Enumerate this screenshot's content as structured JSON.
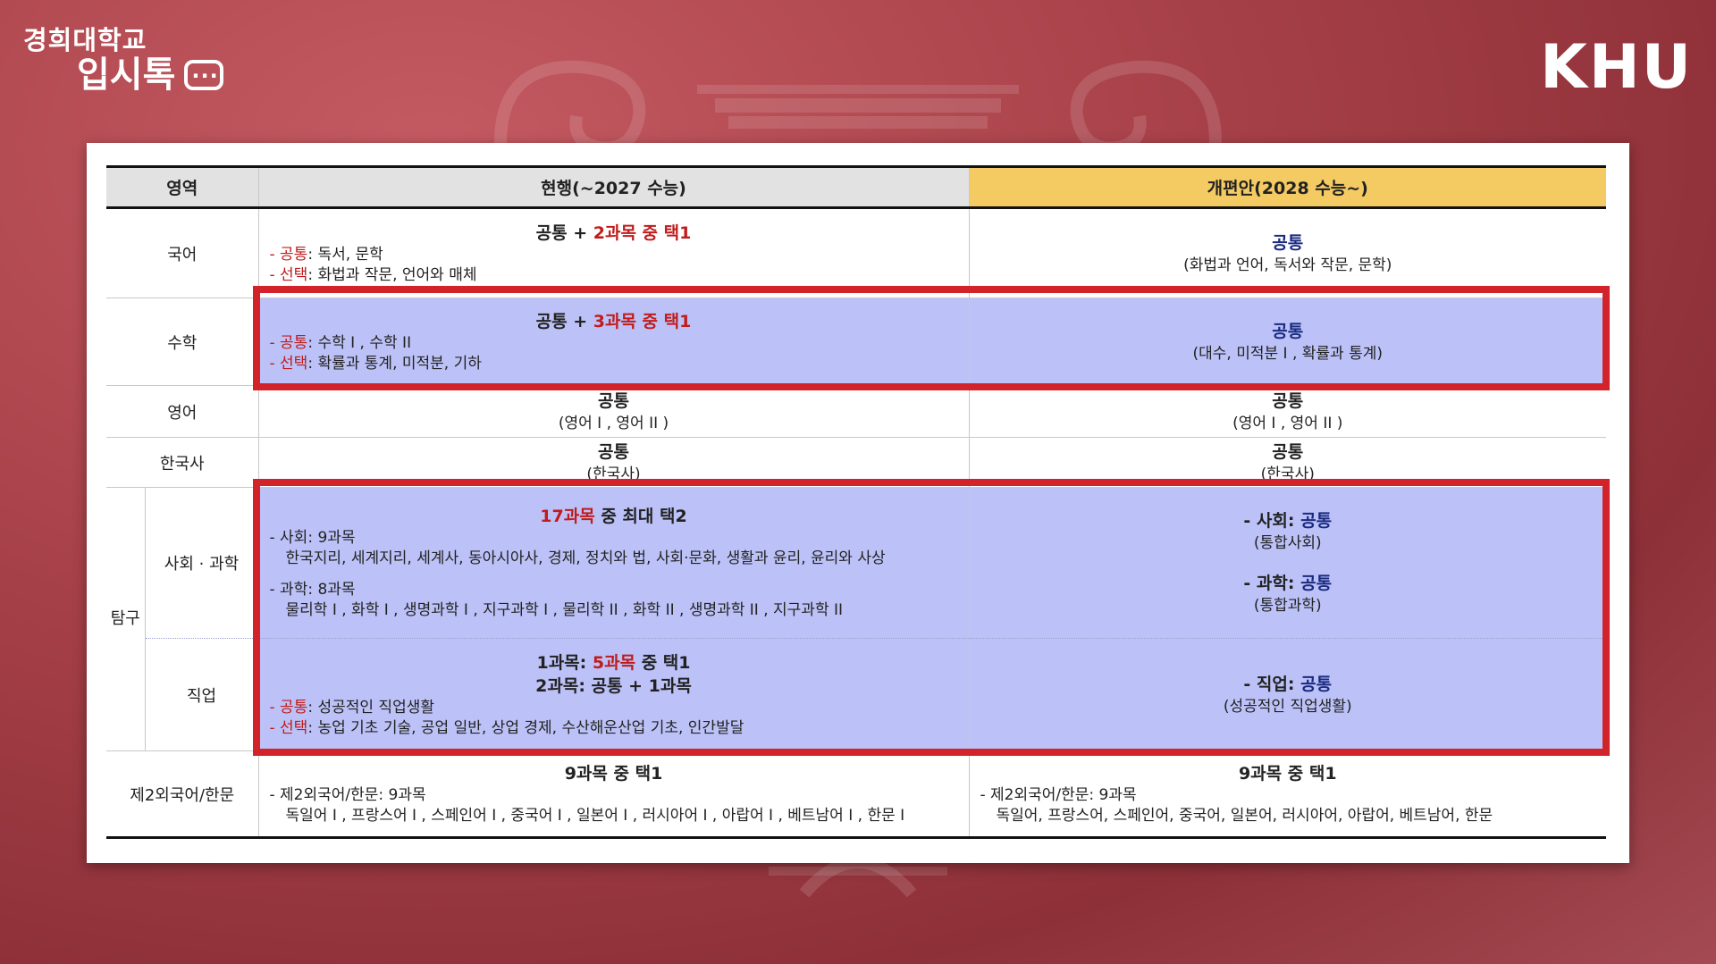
{
  "brand": {
    "line1": "경희대학교",
    "line2": "입시톡",
    "logo": "KHU"
  },
  "colors": {
    "highlight": "#bcc2f7",
    "accent_red": "#c11b1b",
    "header_new": "#f4ca62",
    "box": "#d2232a"
  },
  "table": {
    "headers": {
      "area": "영역",
      "current": "현행(~2027 수능)",
      "new": "개편안(2028 수능~)"
    },
    "korean": {
      "area": "국어",
      "cur_title_a": "공통 + ",
      "cur_title_b": "2과목 중 택1",
      "cur_common_label": "공통",
      "cur_common": ": 독서, 문학",
      "cur_select_label": "선택",
      "cur_select": ": 화법과 작문, 언어와 매체",
      "new_title": "공통",
      "new_sub": "(화법과 언어, 독서와 작문, 문학)"
    },
    "math": {
      "area": "수학",
      "cur_title_a": "공통 + ",
      "cur_title_b": "3과목 중 택1",
      "cur_common_label": "공통",
      "cur_common": ": 수학 I , 수학 II",
      "cur_select_label": "선택",
      "cur_select": ": 확률과 통계, 미적분, 기하",
      "new_title": "공통",
      "new_sub": "(대수, 미적분 I , 확률과 통계)"
    },
    "english": {
      "area": "영어",
      "cur_title": "공통",
      "cur_sub": "(영어 I , 영어 II )",
      "new_title": "공통",
      "new_sub": "(영어 I , 영어 II )"
    },
    "history": {
      "area": "한국사",
      "cur_title": "공통",
      "cur_sub": "(한국사)",
      "new_title": "공통",
      "new_sub": "(한국사)"
    },
    "inquiry": {
      "area": "탐구",
      "social": {
        "area": "사회 · 과학",
        "cur_title_a": "17과목",
        "cur_title_b": " 중 최대 택2",
        "cur_social_head": "사회: 9과목",
        "cur_social_list": "한국지리, 세계지리, 세계사, 동아시아사, 경제, 정치와 법, 사회·문화, 생활과 윤리, 윤리와 사상",
        "cur_science_head": "과학: 8과목",
        "cur_science_list": "물리학 I , 화학 I , 생명과학 I , 지구과학 I , 물리학 II , 화학 II , 생명과학 II , 지구과학 II",
        "new_social_a": "- 사회: ",
        "new_social_b": "공통",
        "new_social_sub": "(통합사회)",
        "new_science_a": "- 과학: ",
        "new_science_b": "공통",
        "new_science_sub": "(통합과학)"
      },
      "job": {
        "area": "직업",
        "cur_line1_a": "1과목: ",
        "cur_line1_b": "5과목",
        "cur_line1_c": " 중 택1",
        "cur_line2": "2과목: 공통 + 1과목",
        "cur_common_label": "공통",
        "cur_common": ": 성공적인 직업생활",
        "cur_select_label": "선택",
        "cur_select": ": 농업 기초 기술, 공업 일반, 상업 경제, 수산해운산업 기초, 인간발달",
        "new_a": "- 직업: ",
        "new_b": "공통",
        "new_sub": "(성공적인 직업생활)"
      }
    },
    "foreign": {
      "area": "제2외국어/한문",
      "cur_title": "9과목 중 택1",
      "cur_head": "제2외국어/한문: 9과목",
      "cur_list": "독일어 I , 프랑스어 I , 스페인어 I , 중국어 I , 일본어 I , 러시아어 I , 아랍어 I , 베트남어 I , 한문 I",
      "new_title": "9과목 중 택1",
      "new_head": "제2외국어/한문: 9과목",
      "new_list": "독일어, 프랑스어, 스페인어, 중국어, 일본어, 러시아어, 아랍어, 베트남어, 한문"
    }
  }
}
